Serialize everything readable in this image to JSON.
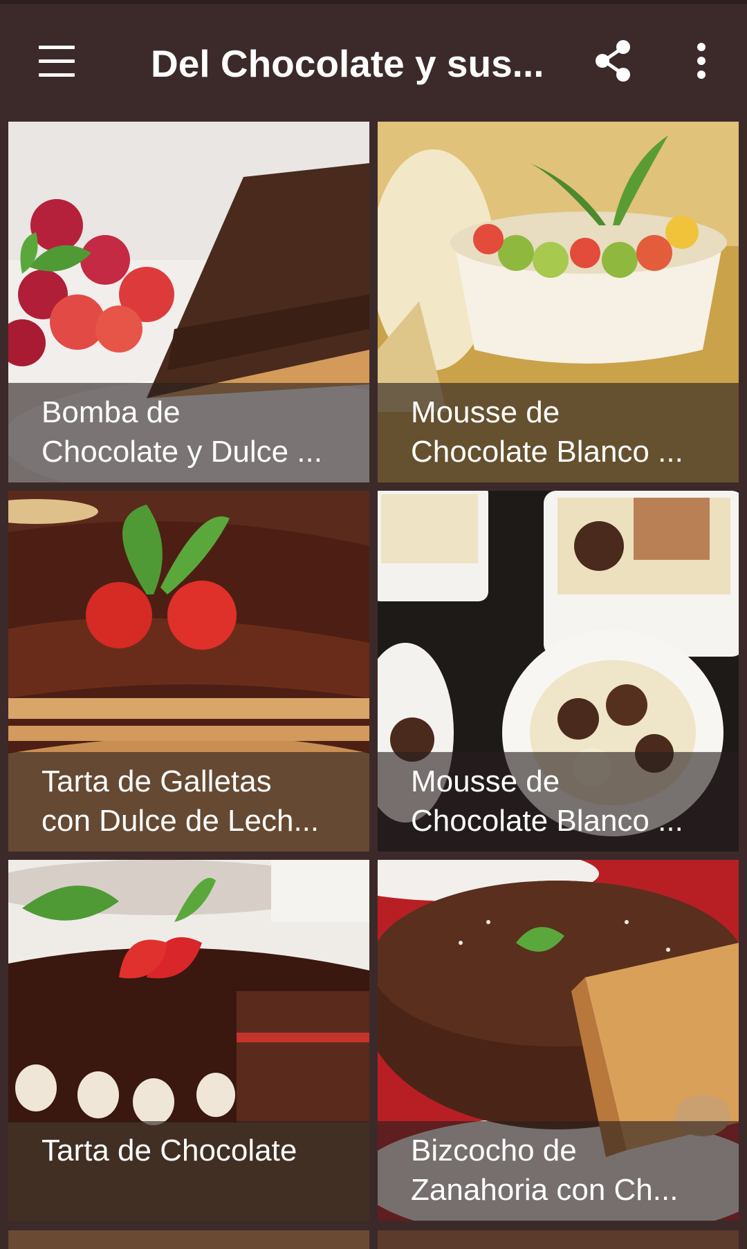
{
  "app_bar": {
    "title": "Del Chocolate y sus...",
    "menu_icon": "hamburger-menu-icon",
    "share_icon": "share-icon",
    "more_icon": "more-vert-icon"
  },
  "colors": {
    "toolbar": "#3c2a2a",
    "caption_overlay": "rgba(40,30,30,0.62)",
    "text": "#ffffff"
  },
  "recipes": [
    {
      "line1": "Bomba de",
      "line2": "Chocolate y Dulce ..."
    },
    {
      "line1": "Mousse de",
      "line2": "Chocolate Blanco ..."
    },
    {
      "line1": "Tarta de Galletas",
      "line2": "con Dulce de Lech..."
    },
    {
      "line1": "Mousse de",
      "line2": "Chocolate Blanco ..."
    },
    {
      "line1": "",
      "line2": "Tarta de Chocolate"
    },
    {
      "line1": "Bizcocho de",
      "line2": "Zanahoria con Ch..."
    }
  ]
}
